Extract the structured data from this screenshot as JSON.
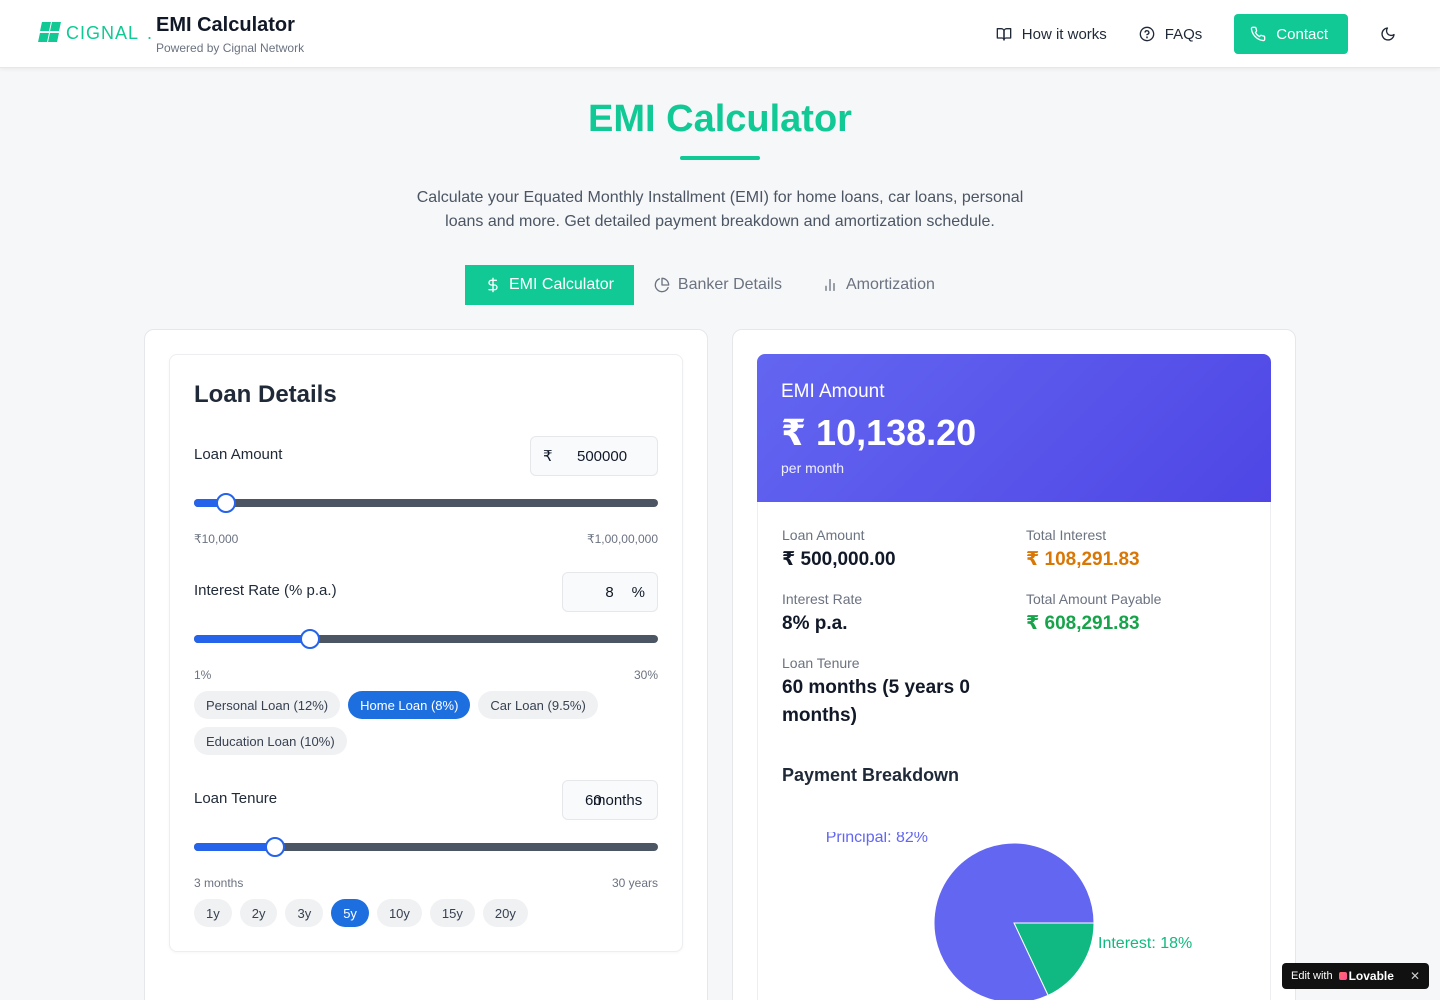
{
  "header": {
    "logo_text": "CIGNAL",
    "title": "EMI Calculator",
    "subtitle": "Powered by Cignal Network",
    "nav": {
      "how_it_works": "How it works",
      "faqs": "FAQs",
      "contact": "Contact"
    }
  },
  "hero": {
    "title": "EMI Calculator",
    "description_line1": "Calculate your Equated Monthly Installment (EMI) for home loans, car loans, personal",
    "description_line2": "loans and more. Get detailed payment breakdown and amortization schedule."
  },
  "tabs": [
    {
      "label": "EMI Calculator",
      "active": true
    },
    {
      "label": "Banker Details",
      "active": false
    },
    {
      "label": "Amortization",
      "active": false
    }
  ],
  "loan_details": {
    "title": "Loan Details",
    "loan_amount": {
      "label": "Loan Amount",
      "currency_symbol": "₹",
      "value": "500000",
      "min_label": "₹10,000",
      "max_label": "₹1,00,00,000",
      "slider_fraction": 0.07
    },
    "interest_rate": {
      "label": "Interest Rate (% p.a.)",
      "value": "8",
      "unit": "%",
      "min_label": "1%",
      "max_label": "30%",
      "slider_fraction": 0.25,
      "presets": [
        {
          "label": "Personal Loan (12%)",
          "active": false
        },
        {
          "label": "Home Loan (8%)",
          "active": true
        },
        {
          "label": "Car Loan (9.5%)",
          "active": false
        },
        {
          "label": "Education Loan (10%)",
          "active": false
        }
      ]
    },
    "tenure": {
      "label": "Loan Tenure",
      "value": "60",
      "unit": "months",
      "min_label": "3 months",
      "max_label": "30 years",
      "slider_fraction": 0.175,
      "presets": [
        {
          "label": "1y",
          "active": false
        },
        {
          "label": "2y",
          "active": false
        },
        {
          "label": "3y",
          "active": false
        },
        {
          "label": "5y",
          "active": true
        },
        {
          "label": "10y",
          "active": false
        },
        {
          "label": "15y",
          "active": false
        },
        {
          "label": "20y",
          "active": false
        }
      ]
    }
  },
  "result": {
    "emi_label": "EMI Amount",
    "emi_value": "₹ 10,138.20",
    "emi_period": "per month",
    "loan_amount_label": "Loan Amount",
    "loan_amount_value": "₹ 500,000.00",
    "total_interest_label": "Total Interest",
    "total_interest_value": "₹ 108,291.83",
    "interest_rate_label": "Interest Rate",
    "interest_rate_value": "8% p.a.",
    "total_payable_label": "Total Amount Payable",
    "total_payable_value": "₹ 608,291.83",
    "tenure_label": "Loan Tenure",
    "tenure_value_line1": "60 months (5 years 0",
    "tenure_value_line2": "months)",
    "breakdown_title": "Payment Breakdown"
  },
  "chart_data": {
    "type": "pie",
    "labels": [
      "Principal: 82%",
      "Interest: 18%"
    ],
    "values": [
      82,
      18
    ],
    "colors": [
      "#6366f1",
      "#10b981"
    ]
  },
  "colors": {
    "brand": "#10c995",
    "slider": "#2563eb",
    "emi_banner": "#5b5be8",
    "interest": "#d97706",
    "payable": "#16a34a"
  },
  "badge": {
    "prefix": "Edit with",
    "name": "Lovable"
  }
}
